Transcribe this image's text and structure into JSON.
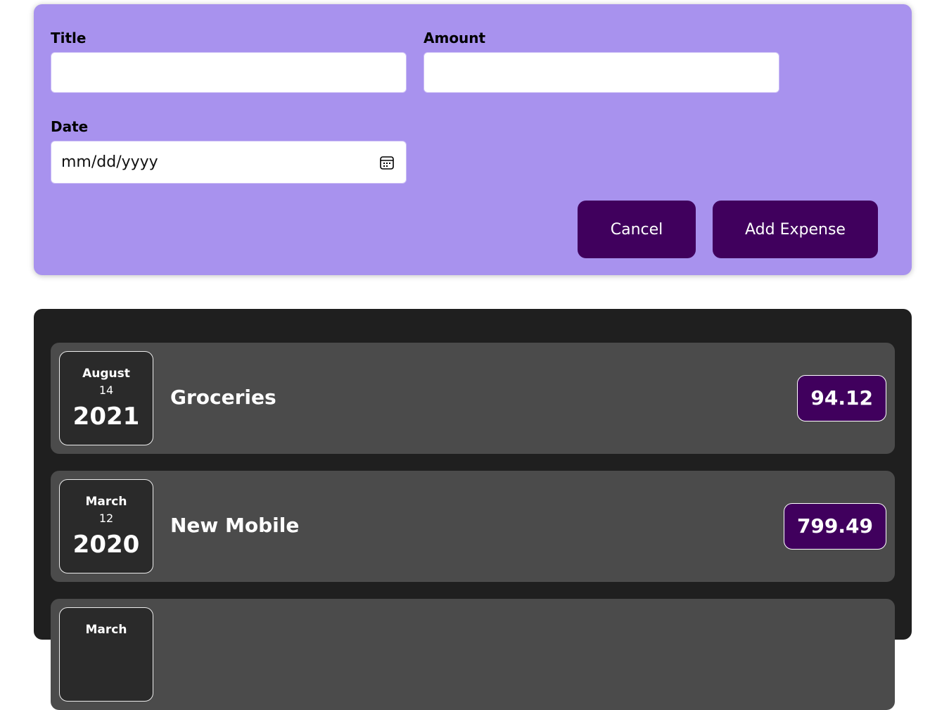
{
  "form": {
    "title_label": "Title",
    "title_value": "",
    "amount_label": "Amount",
    "amount_value": "",
    "date_label": "Date",
    "date_placeholder": "mm/dd/yyyy",
    "cancel_label": "Cancel",
    "add_label": "Add Expense",
    "calendar_icon": "calendar-icon"
  },
  "colors": {
    "form_bg": "#a892ee",
    "button_bg": "#40005d",
    "list_bg": "#1f1f1f",
    "item_bg": "#4b4b4b",
    "date_card_bg": "#2a2a2a"
  },
  "expenses": [
    {
      "month": "August",
      "day": "14",
      "year": "2021",
      "title": "Groceries",
      "amount": "94.12"
    },
    {
      "month": "March",
      "day": "12",
      "year": "2020",
      "title": "New Mobile",
      "amount": "799.49"
    },
    {
      "month": "March",
      "day": "",
      "year": "",
      "title": "",
      "amount": ""
    }
  ]
}
